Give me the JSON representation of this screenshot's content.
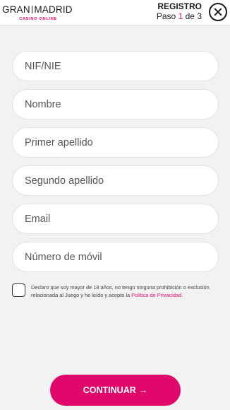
{
  "brand": {
    "name_left": "GRAN",
    "name_right": "MADRID",
    "tagline": "CASINO ONLINE",
    "accent_color": "#e4106a"
  },
  "step": {
    "title": "REGISTRO",
    "label": "Paso",
    "current": "1",
    "separator": "de",
    "total": "3"
  },
  "close": {
    "icon": "close-icon"
  },
  "form": {
    "fields": [
      {
        "placeholder": "NIF/NIE",
        "value": ""
      },
      {
        "placeholder": "Nombre",
        "value": ""
      },
      {
        "placeholder": "Primer apellido",
        "value": ""
      },
      {
        "placeholder": "Segundo apellido",
        "value": ""
      },
      {
        "placeholder": "Email",
        "value": ""
      },
      {
        "placeholder": "Número de móvil",
        "value": ""
      }
    ]
  },
  "consent": {
    "text": "Declaro que soy mayor de 18 años, no tengo ninguna prohibición o exclusión relacionada al Juego y he leído y acepto la ",
    "link": "Política de Privacidad",
    "suffix": ".",
    "checked": false
  },
  "actions": {
    "continue_label": "CONTINUAR",
    "continue_arrow": "→",
    "continue_color": "#e0086a"
  }
}
